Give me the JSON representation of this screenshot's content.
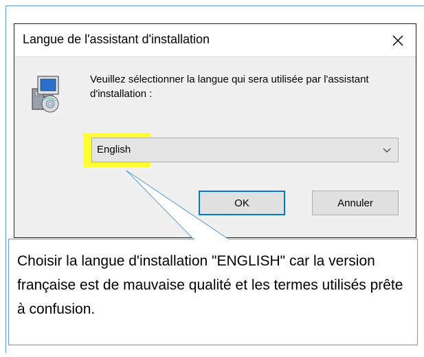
{
  "dialog": {
    "title": "Langue de l'assistant d'installation",
    "close_icon": "close-icon",
    "app_icon": "setup-installer-icon",
    "prompt": "Veuillez sélectionner la langue qui sera utilisée par l'assistant d'installation :",
    "language_select": {
      "value": "English",
      "arrow_icon": "chevron-down-icon"
    },
    "ok_label": "OK",
    "cancel_label": "Annuler"
  },
  "callout": {
    "text": "Choisir la langue d'installation \"ENGLISH\" car la version française est de mauvaise qualité et les termes utilisés prête à confusion."
  },
  "colors": {
    "highlight": "#ffff33",
    "callout_border": "#5b9bd5",
    "default_button_border": "#0078d7",
    "dialog_background": "#f0f0f0"
  }
}
